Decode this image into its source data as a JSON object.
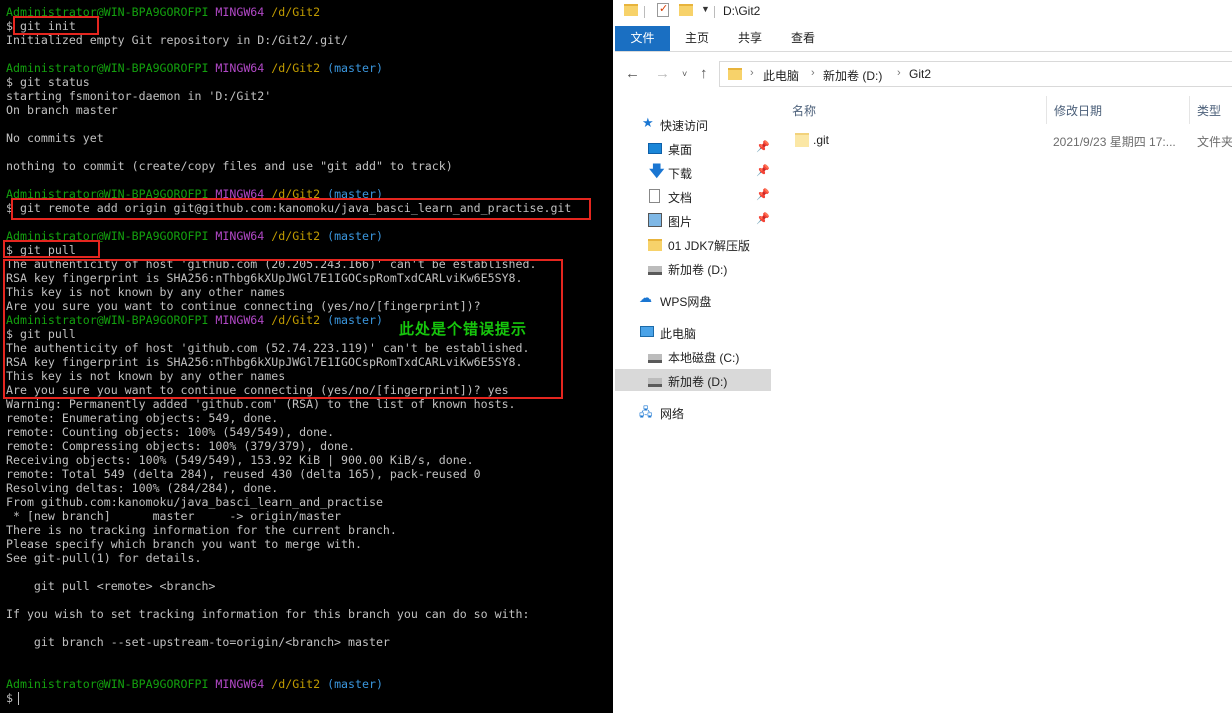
{
  "terminal": {
    "lines": [
      [
        {
          "t": "Administrator@WIN-BPA9GOROFPI ",
          "c": "c-user"
        },
        {
          "t": "MINGW64 ",
          "c": "c-sys"
        },
        {
          "t": "/d/Git2",
          "c": "c-path"
        }
      ],
      [
        {
          "t": "$ git init",
          "c": ""
        }
      ],
      [
        {
          "t": "Initialized empty Git repository in D:/Git2/.git/",
          "c": ""
        }
      ],
      [],
      [
        {
          "t": "Administrator@WIN-BPA9GOROFPI ",
          "c": "c-user"
        },
        {
          "t": "MINGW64 ",
          "c": "c-sys"
        },
        {
          "t": "/d/Git2 ",
          "c": "c-path"
        },
        {
          "t": "(master)",
          "c": "c-br"
        }
      ],
      [
        {
          "t": "$ git status",
          "c": ""
        }
      ],
      [
        {
          "t": "starting fsmonitor-daemon in 'D:/Git2'",
          "c": ""
        }
      ],
      [
        {
          "t": "On branch master",
          "c": ""
        }
      ],
      [],
      [
        {
          "t": "No commits yet",
          "c": ""
        }
      ],
      [],
      [
        {
          "t": "nothing to commit (create/copy files and use \"git add\" to track)",
          "c": ""
        }
      ],
      [],
      [
        {
          "t": "Administrator@WIN-BPA9GOROFPI ",
          "c": "c-user"
        },
        {
          "t": "MINGW64 ",
          "c": "c-sys"
        },
        {
          "t": "/d/Git2 ",
          "c": "c-path"
        },
        {
          "t": "(master)",
          "c": "c-br"
        }
      ],
      [
        {
          "t": "$ git remote add origin git@github.com:kanomoku/java_basci_learn_and_practise.git",
          "c": ""
        }
      ],
      [],
      [
        {
          "t": "Administrator@WIN-BPA9GOROFPI ",
          "c": "c-user"
        },
        {
          "t": "MINGW64 ",
          "c": "c-sys"
        },
        {
          "t": "/d/Git2 ",
          "c": "c-path"
        },
        {
          "t": "(master)",
          "c": "c-br"
        }
      ],
      [
        {
          "t": "$ git pull",
          "c": ""
        }
      ],
      [
        {
          "t": "The authenticity of host 'github.com (20.205.243.166)' can't be established.",
          "c": ""
        }
      ],
      [
        {
          "t": "RSA key fingerprint is SHA256:nThbg6kXUpJWGl7E1IGOCspRomTxdCARLviKw6E5SY8.",
          "c": ""
        }
      ],
      [
        {
          "t": "This key is not known by any other names",
          "c": ""
        }
      ],
      [
        {
          "t": "Are you sure you want to continue connecting (yes/no/[fingerprint])?",
          "c": ""
        }
      ],
      [
        {
          "t": "Administrator@WIN-BPA9GOROFPI ",
          "c": "c-user"
        },
        {
          "t": "MINGW64 ",
          "c": "c-sys"
        },
        {
          "t": "/d/Git2 ",
          "c": "c-path"
        },
        {
          "t": "(master)",
          "c": "c-br"
        }
      ],
      [
        {
          "t": "$ git pull",
          "c": ""
        }
      ],
      [
        {
          "t": "The authenticity of host 'github.com (52.74.223.119)' can't be established.",
          "c": ""
        }
      ],
      [
        {
          "t": "RSA key fingerprint is SHA256:nThbg6kXUpJWGl7E1IGOCspRomTxdCARLviKw6E5SY8.",
          "c": ""
        }
      ],
      [
        {
          "t": "This key is not known by any other names",
          "c": ""
        }
      ],
      [
        {
          "t": "Are you sure you want to continue connecting (yes/no/[fingerprint])? yes",
          "c": ""
        }
      ],
      [
        {
          "t": "Warning: Permanently added 'github.com' (RSA) to the list of known hosts.",
          "c": ""
        }
      ],
      [
        {
          "t": "remote: Enumerating objects: 549, done.",
          "c": ""
        }
      ],
      [
        {
          "t": "remote: Counting objects: 100% (549/549), done.",
          "c": ""
        }
      ],
      [
        {
          "t": "remote: Compressing objects: 100% (379/379), done.",
          "c": ""
        }
      ],
      [
        {
          "t": "Receiving objects: 100% (549/549), 153.92 KiB | 900.00 KiB/s, done.",
          "c": ""
        }
      ],
      [
        {
          "t": "remote: Total 549 (delta 284), reused 430 (delta 165), pack-reused 0",
          "c": ""
        }
      ],
      [
        {
          "t": "Resolving deltas: 100% (284/284), done.",
          "c": ""
        }
      ],
      [
        {
          "t": "From github.com:kanomoku/java_basci_learn_and_practise",
          "c": ""
        }
      ],
      [
        {
          "t": " * [new branch]      master     -> origin/master",
          "c": ""
        }
      ],
      [
        {
          "t": "There is no tracking information for the current branch.",
          "c": ""
        }
      ],
      [
        {
          "t": "Please specify which branch you want to merge with.",
          "c": ""
        }
      ],
      [
        {
          "t": "See git-pull(1) for details.",
          "c": ""
        }
      ],
      [],
      [
        {
          "t": "    git pull <remote> <branch>",
          "c": ""
        }
      ],
      [],
      [
        {
          "t": "If you wish to set tracking information for this branch you can do so with:",
          "c": ""
        }
      ],
      [],
      [
        {
          "t": "    git branch --set-upstream-to=origin/<branch> master",
          "c": ""
        }
      ],
      [],
      [],
      [
        {
          "t": "Administrator@WIN-BPA9GOROFPI ",
          "c": "c-user"
        },
        {
          "t": "MINGW64 ",
          "c": "c-sys"
        },
        {
          "t": "/d/Git2 ",
          "c": "c-path"
        },
        {
          "t": "(master)",
          "c": "c-br"
        }
      ],
      [
        {
          "t": "$ ",
          "c": ""
        }
      ]
    ],
    "annotation": "此处是个错误提示",
    "colors": {
      "user": "#13a10e",
      "system": "#b148c6",
      "path": "#c19c00",
      "branch": "#3a96dd",
      "highlight": "#e5261f",
      "annotation": "#16c60c"
    }
  },
  "explorer": {
    "title": "D:\\Git2",
    "ribbon_tabs": {
      "file": "文件",
      "home": "主页",
      "share": "共享",
      "view": "查看"
    },
    "breadcrumb": {
      "pc": "此电脑",
      "drive": "新加卷 (D:)",
      "folder": "Git2"
    },
    "columns": {
      "name": "名称",
      "modified": "修改日期",
      "type": "类型"
    },
    "nav": {
      "quick_access": "快速访问",
      "desktop": "桌面",
      "downloads": "下载",
      "documents": "文档",
      "pictures": "图片",
      "jdk": "01 JDK7解压版",
      "drive_d_quick": "新加卷 (D:)",
      "wps": "WPS网盘",
      "this_pc": "此电脑",
      "local_c": "本地磁盘 (C:)",
      "drive_d": "新加卷 (D:)",
      "network": "网络"
    },
    "files": [
      {
        "name": ".git",
        "modified": "2021/9/23 星期四 17:...",
        "type": "文件夹"
      }
    ],
    "accent": "#1a6fc2"
  }
}
